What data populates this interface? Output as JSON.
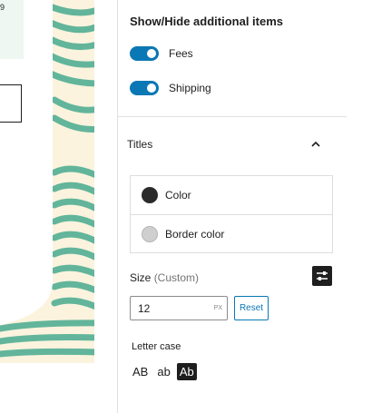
{
  "canvas": {
    "summary_value": "9"
  },
  "inspector": {
    "section_title": "Show/Hide additional items",
    "toggles": [
      {
        "label": "Fees",
        "on": true
      },
      {
        "label": "Shipping",
        "on": true
      }
    ],
    "titles_panel": {
      "label": "Titles",
      "expanded": true
    },
    "colors": [
      {
        "label": "Color",
        "swatch": "#2b2b2b"
      },
      {
        "label": "Border color",
        "swatch": "#cfcfcf"
      }
    ],
    "size": {
      "label": "Size",
      "mode": "(Custom)",
      "value": "12",
      "unit": "PX",
      "reset_label": "Reset"
    },
    "letter_case": {
      "label": "Letter case",
      "options": [
        "AB",
        "ab",
        "Ab"
      ],
      "selected": "Ab"
    }
  },
  "theme": {
    "accent": "#0a78b4",
    "pattern_green": "#62b59a",
    "pattern_cream": "#fbf3de"
  }
}
